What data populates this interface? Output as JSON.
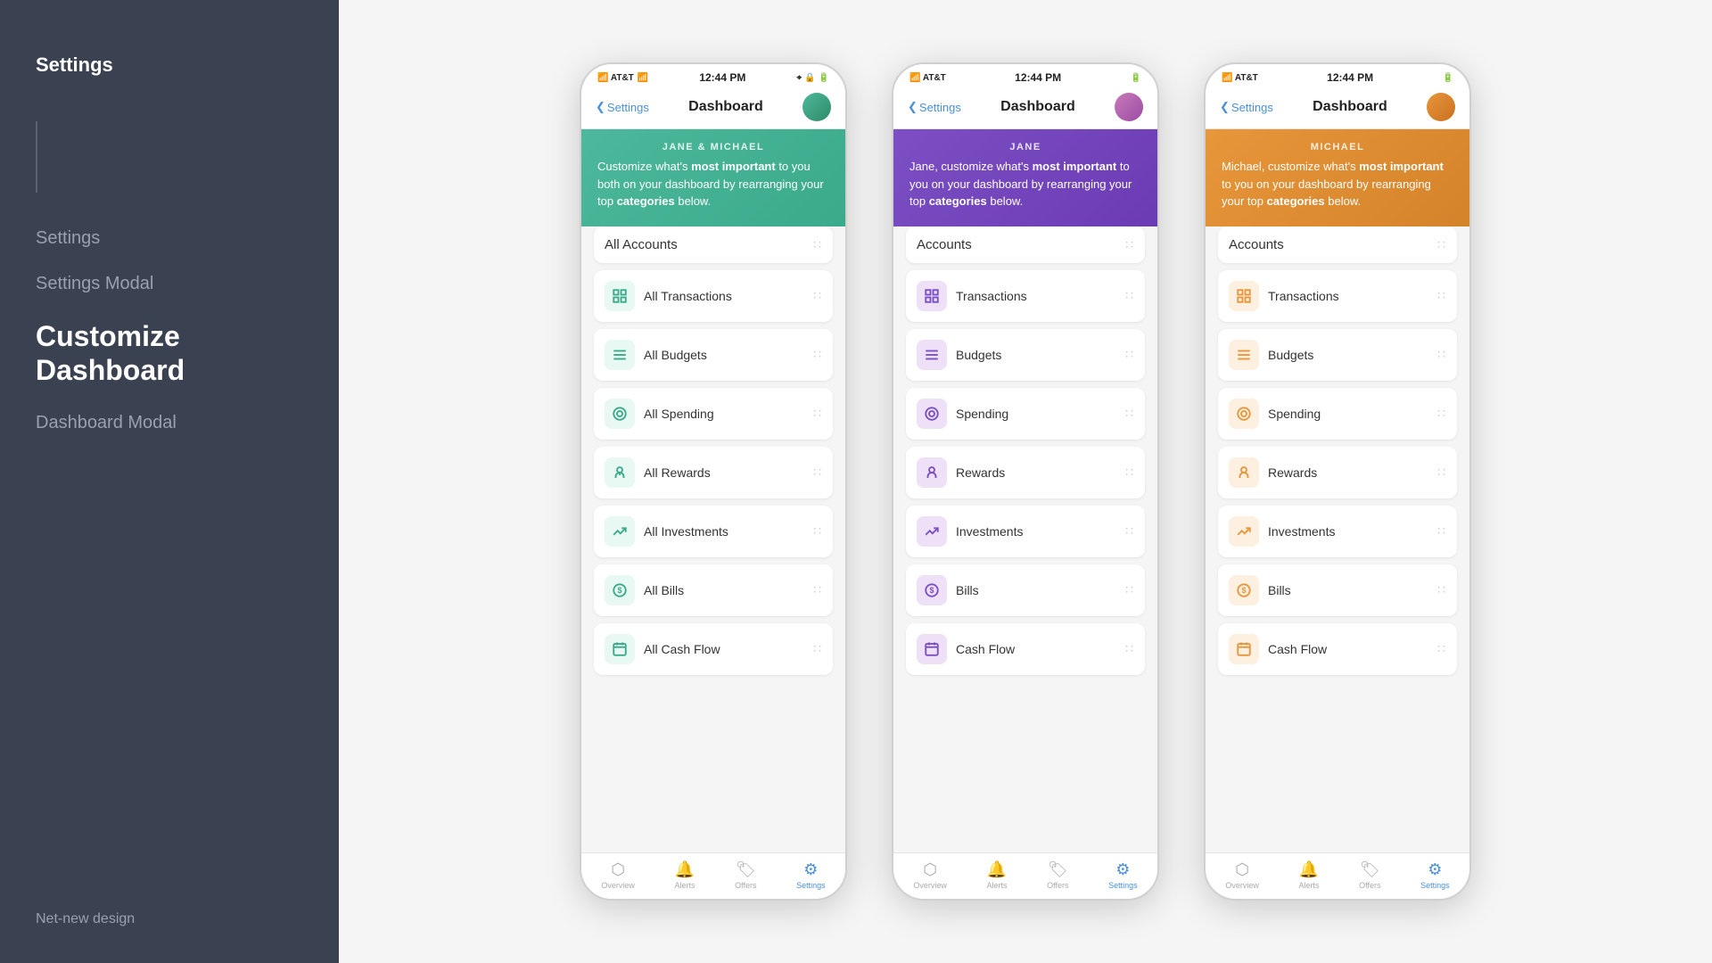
{
  "sidebar": {
    "top_label": "Settings",
    "nav_items": [
      {
        "label": "Settings",
        "active": false
      },
      {
        "label": "Settings Modal",
        "active": false
      },
      {
        "label": "Customize Dashboard",
        "active": true
      },
      {
        "label": "Dashboard Modal",
        "active": false
      }
    ],
    "bottom_label": "Net-new design"
  },
  "phones": [
    {
      "id": "combined",
      "theme": "green",
      "status_bar": {
        "carrier": "AT&T",
        "time": "12:44 PM",
        "battery": "▐▌"
      },
      "nav": {
        "back_label": "Settings",
        "title": "Dashboard"
      },
      "banner": {
        "name": "JANE & MICHAEL",
        "text_start": "Customize what's ",
        "bold1": "most important",
        "text_mid": " to you both on your dashboard by rearranging your top ",
        "bold2": "categories",
        "text_end": " below."
      },
      "items": [
        {
          "label": "All Accounts",
          "icon": null
        },
        {
          "label": "All Transactions",
          "icon": "grid"
        },
        {
          "label": "All Budgets",
          "icon": "bars"
        },
        {
          "label": "All Spending",
          "icon": "circle"
        },
        {
          "label": "All Rewards",
          "icon": "ribbon"
        },
        {
          "label": "All Investments",
          "icon": "chart"
        },
        {
          "label": "All Bills",
          "icon": "dollar"
        },
        {
          "label": "All Cash Flow",
          "icon": "calendar"
        }
      ]
    },
    {
      "id": "jane",
      "theme": "purple",
      "status_bar": {
        "carrier": "AT&T",
        "time": "12:44 PM",
        "battery": "▐▌"
      },
      "nav": {
        "back_label": "Settings",
        "title": "Dashboard"
      },
      "banner": {
        "name": "JANE",
        "text_start": "Jane, customize what's ",
        "bold1": "most important",
        "text_mid": " to you on your dashboard by rearranging your top ",
        "bold2": "categories",
        "text_end": " below."
      },
      "items": [
        {
          "label": "Accounts",
          "icon": null
        },
        {
          "label": "Transactions",
          "icon": "grid"
        },
        {
          "label": "Budgets",
          "icon": "bars"
        },
        {
          "label": "Spending",
          "icon": "circle"
        },
        {
          "label": "Rewards",
          "icon": "ribbon"
        },
        {
          "label": "Investments",
          "icon": "chart"
        },
        {
          "label": "Bills",
          "icon": "dollar"
        },
        {
          "label": "Cash Flow",
          "icon": "calendar"
        }
      ]
    },
    {
      "id": "michael",
      "theme": "orange",
      "status_bar": {
        "carrier": "AT&T",
        "time": "12:44 PM",
        "battery": "▐▌"
      },
      "nav": {
        "back_label": "Settings",
        "title": "Dashboard"
      },
      "banner": {
        "name": "MICHAEL",
        "text_start": "Michael, customize what's ",
        "bold1": "most important",
        "text_mid": " to you on your dashboard by rearranging your top ",
        "bold2": "categories",
        "text_end": " below."
      },
      "items": [
        {
          "label": "Accounts",
          "icon": null
        },
        {
          "label": "Transactions",
          "icon": "grid"
        },
        {
          "label": "Budgets",
          "icon": "bars"
        },
        {
          "label": "Spending",
          "icon": "circle"
        },
        {
          "label": "Rewards",
          "icon": "ribbon"
        },
        {
          "label": "Investments",
          "icon": "chart"
        },
        {
          "label": "Bills",
          "icon": "dollar"
        },
        {
          "label": "Cash Flow",
          "icon": "calendar"
        }
      ]
    }
  ],
  "tab_bar": {
    "items": [
      {
        "label": "Overview",
        "icon": "⬡",
        "active": false
      },
      {
        "label": "Alerts",
        "icon": "🔔",
        "active": false
      },
      {
        "label": "Offers",
        "icon": "🏷",
        "active": false
      },
      {
        "label": "Settings",
        "icon": "⚙",
        "active": true
      }
    ]
  }
}
